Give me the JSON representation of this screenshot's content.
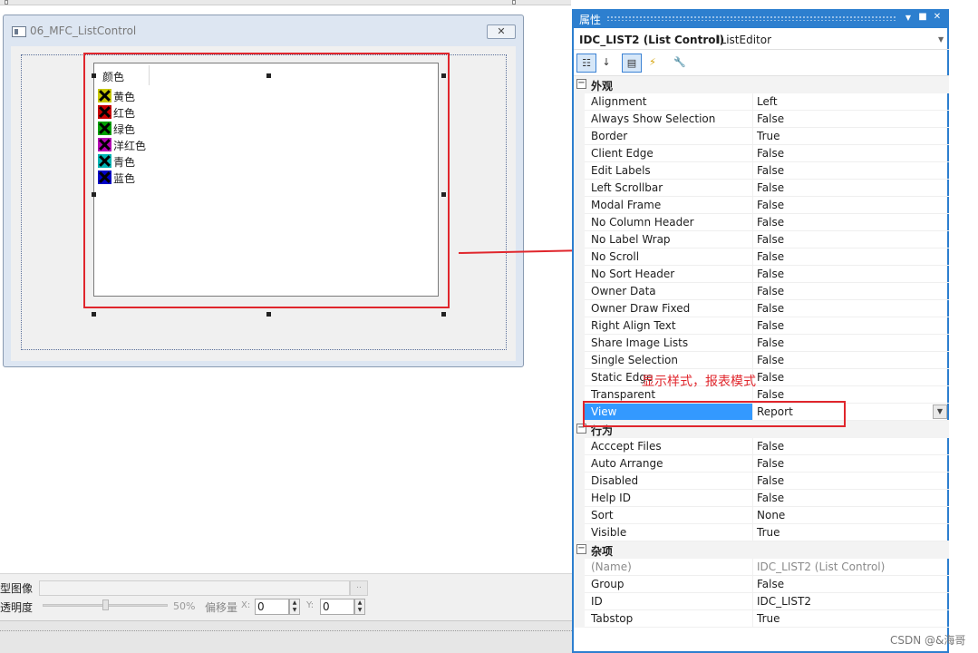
{
  "dialog": {
    "title": "06_MFC_ListControl",
    "close_label": "✕",
    "list_header": "颜色",
    "list_items": [
      {
        "label": "黄色",
        "color": "#c8c800"
      },
      {
        "label": "红色",
        "color": "#c80000"
      },
      {
        "label": "绿色",
        "color": "#00a000"
      },
      {
        "label": "洋红色",
        "color": "#b400b4"
      },
      {
        "label": "青色",
        "color": "#00b4b4"
      },
      {
        "label": "蓝色",
        "color": "#0000c8"
      }
    ]
  },
  "bottom_panel": {
    "image_label": "型图像",
    "browse_label": "..",
    "opacity_label": "透明度",
    "opacity_percent": "50%",
    "offset_label": "偏移量",
    "x_label": "X:",
    "x_value": "0",
    "y_label": "Y:",
    "y_value": "0"
  },
  "properties": {
    "title": "属性",
    "object_name": "IDC_LIST2 (List Control)",
    "object_type": "IListEditor",
    "categories": [
      {
        "label": "外观",
        "rows": [
          {
            "name": "Alignment",
            "value": "Left"
          },
          {
            "name": "Always Show Selection",
            "value": "False"
          },
          {
            "name": "Border",
            "value": "True"
          },
          {
            "name": "Client Edge",
            "value": "False"
          },
          {
            "name": "Edit Labels",
            "value": "False"
          },
          {
            "name": "Left Scrollbar",
            "value": "False"
          },
          {
            "name": "Modal Frame",
            "value": "False"
          },
          {
            "name": "No Column Header",
            "value": "False"
          },
          {
            "name": "No Label Wrap",
            "value": "False"
          },
          {
            "name": "No Scroll",
            "value": "False"
          },
          {
            "name": "No Sort Header",
            "value": "False"
          },
          {
            "name": "Owner Data",
            "value": "False"
          },
          {
            "name": "Owner Draw Fixed",
            "value": "False"
          },
          {
            "name": "Right Align Text",
            "value": "False"
          },
          {
            "name": "Share Image Lists",
            "value": "False"
          },
          {
            "name": "Single Selection",
            "value": "False"
          },
          {
            "name": "Static Edge",
            "value": "False"
          },
          {
            "name": "Transparent",
            "value": "False"
          },
          {
            "name": "View",
            "value": "Report",
            "selected": true
          }
        ]
      },
      {
        "label": "行为",
        "rows": [
          {
            "name": "Acccept Files",
            "value": "False"
          },
          {
            "name": "Auto Arrange",
            "value": "False"
          },
          {
            "name": "Disabled",
            "value": "False"
          },
          {
            "name": "Help ID",
            "value": "False"
          },
          {
            "name": "Sort",
            "value": "None"
          },
          {
            "name": "Visible",
            "value": "True"
          }
        ]
      },
      {
        "label": "杂项",
        "rows": [
          {
            "name": "(Name)",
            "value": "IDC_LIST2 (List Control)",
            "dim": true
          },
          {
            "name": "Group",
            "value": "False"
          },
          {
            "name": "ID",
            "value": "IDC_LIST2"
          },
          {
            "name": "Tabstop",
            "value": "True"
          }
        ]
      }
    ]
  },
  "annotation": "显示样式，报表模式",
  "watermark": "CSDN @&海哥"
}
